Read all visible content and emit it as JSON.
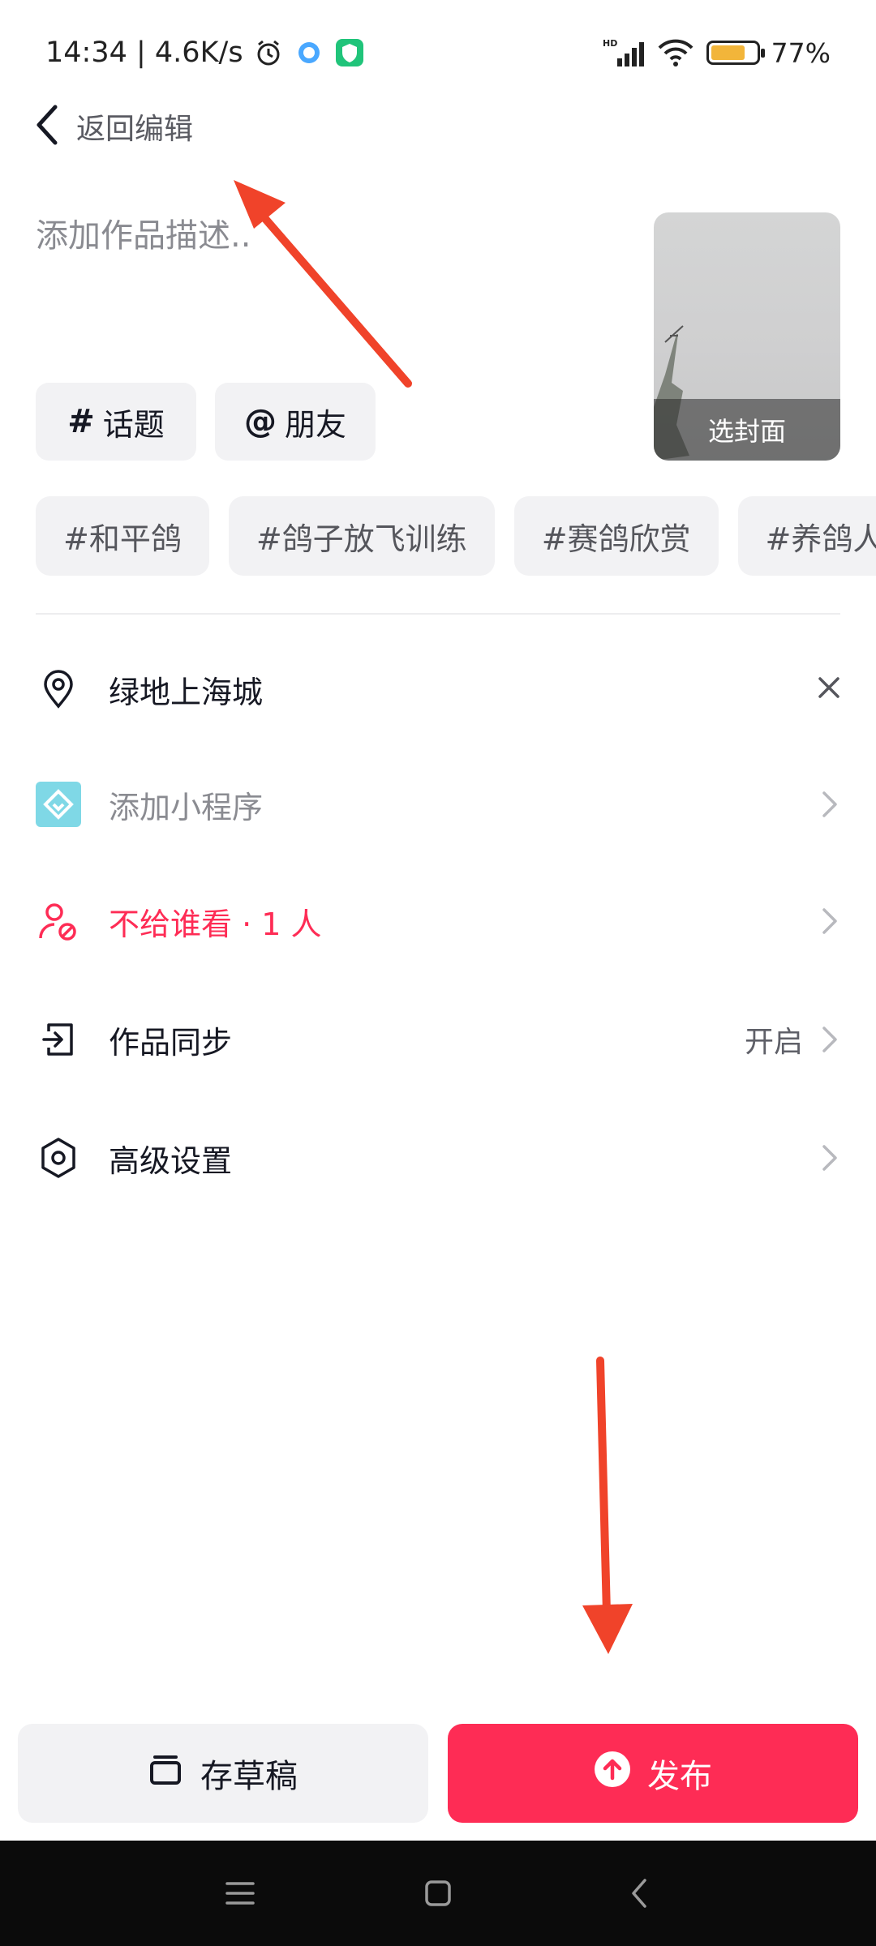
{
  "status_bar": {
    "time_speed": "14:34 | 4.6K/s",
    "network": "HD",
    "battery_percent": "77%",
    "battery_level": 0.77,
    "icons": [
      "alarm-icon",
      "browser-icon",
      "shield-app-icon",
      "signal-icon",
      "wifi-icon",
      "battery-icon"
    ]
  },
  "header": {
    "back_label": "返回编辑"
  },
  "description": {
    "placeholder": "添加作品描述.."
  },
  "cover": {
    "label": "选封面"
  },
  "buttons": {
    "topic_label": "话题",
    "topic_symbol": "#",
    "friends_label": "朋友",
    "friends_symbol": "@"
  },
  "topic_chips": [
    "#和平鸽",
    "#鸽子放飞训练",
    "#赛鸽欣赏",
    "#养鸽人"
  ],
  "settings": {
    "location": {
      "label": "绿地上海城",
      "icon": "location-pin-icon"
    },
    "mini_program": {
      "label": "添加小程序",
      "icon": "mini-program-icon"
    },
    "privacy": {
      "label": "不给谁看 · 1 人",
      "icon": "user-block-icon",
      "color": "#fe2c55"
    },
    "sync": {
      "label": "作品同步",
      "value": "开启",
      "icon": "sync-export-icon"
    },
    "advanced": {
      "label": "高级设置",
      "icon": "settings-hex-icon"
    }
  },
  "bottom": {
    "draft_label": "存草稿",
    "publish_label": "发布"
  },
  "colors": {
    "accent": "#fe2c55",
    "pill_bg": "#f2f2f4",
    "annotation": "#f0432a"
  }
}
